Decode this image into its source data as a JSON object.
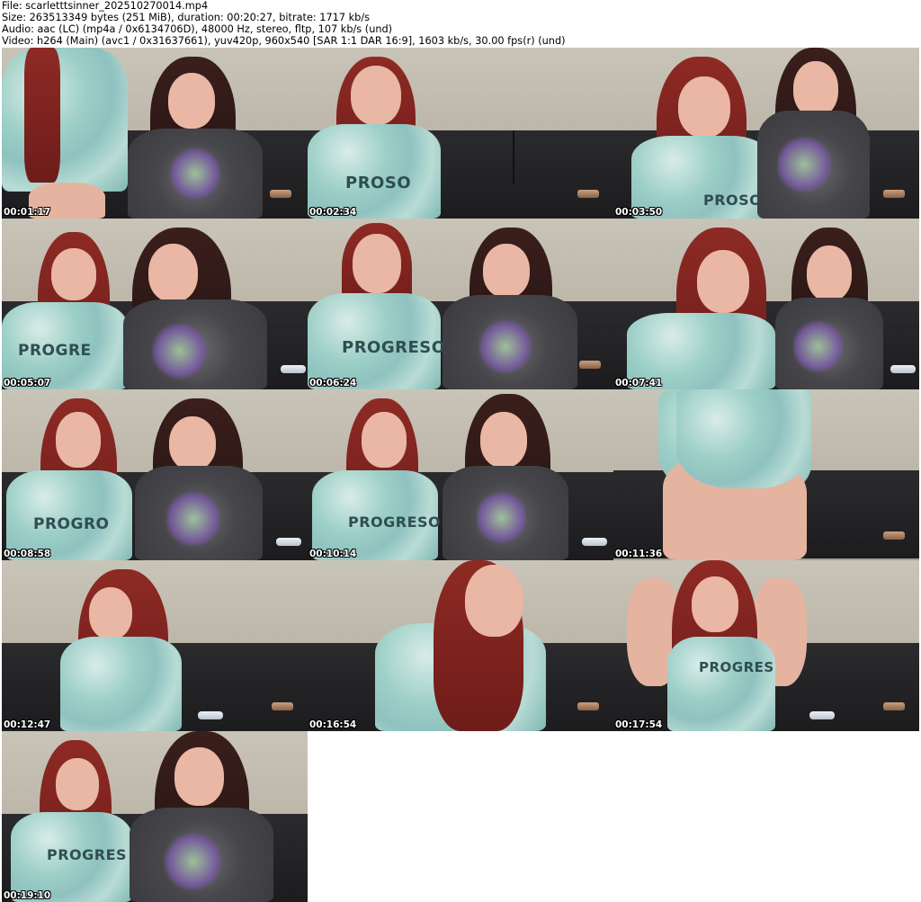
{
  "header": {
    "file_line": "File: scarletttsinner_202510270014.mp4",
    "size_line": "Size: 263513349 bytes (251 MiB), duration: 00:20:27, bitrate: 1717 kb/s",
    "audio_line": "Audio: aac (LC) (mp4a / 0x6134706D), 48000 Hz, stereo, fltp, 107 kb/s (und)",
    "video_line": "Video: h264 (Main) (avc1 / 0x31637661), yuv420p, 960x540 [SAR 1:1 DAR 16:9], 1603 kb/s, 30.00 fps(r) (und)"
  },
  "thumbnails": [
    {
      "timestamp": "00:01:17",
      "shirt_text": ""
    },
    {
      "timestamp": "00:02:34",
      "shirt_text": "PROSO"
    },
    {
      "timestamp": "00:03:50",
      "shirt_text": "PROSO"
    },
    {
      "timestamp": "00:05:07",
      "shirt_text": "PROGRE"
    },
    {
      "timestamp": "00:06:24",
      "shirt_text": "PROGRESO"
    },
    {
      "timestamp": "00:07:41",
      "shirt_text": ""
    },
    {
      "timestamp": "00:08:58",
      "shirt_text": "PROGRO"
    },
    {
      "timestamp": "00:10:14",
      "shirt_text": "PROGRESO"
    },
    {
      "timestamp": "00:11:36",
      "shirt_text": ""
    },
    {
      "timestamp": "00:12:47",
      "shirt_text": ""
    },
    {
      "timestamp": "00:16:54",
      "shirt_text": ""
    },
    {
      "timestamp": "00:17:54",
      "shirt_text": "PROGRES"
    },
    {
      "timestamp": "00:19:10",
      "shirt_text": "PROGRES"
    }
  ],
  "colors": {
    "background": "#ffffff",
    "header_text": "#000000",
    "timestamp_text": "#ffffff",
    "timestamp_outline": "#000000"
  }
}
